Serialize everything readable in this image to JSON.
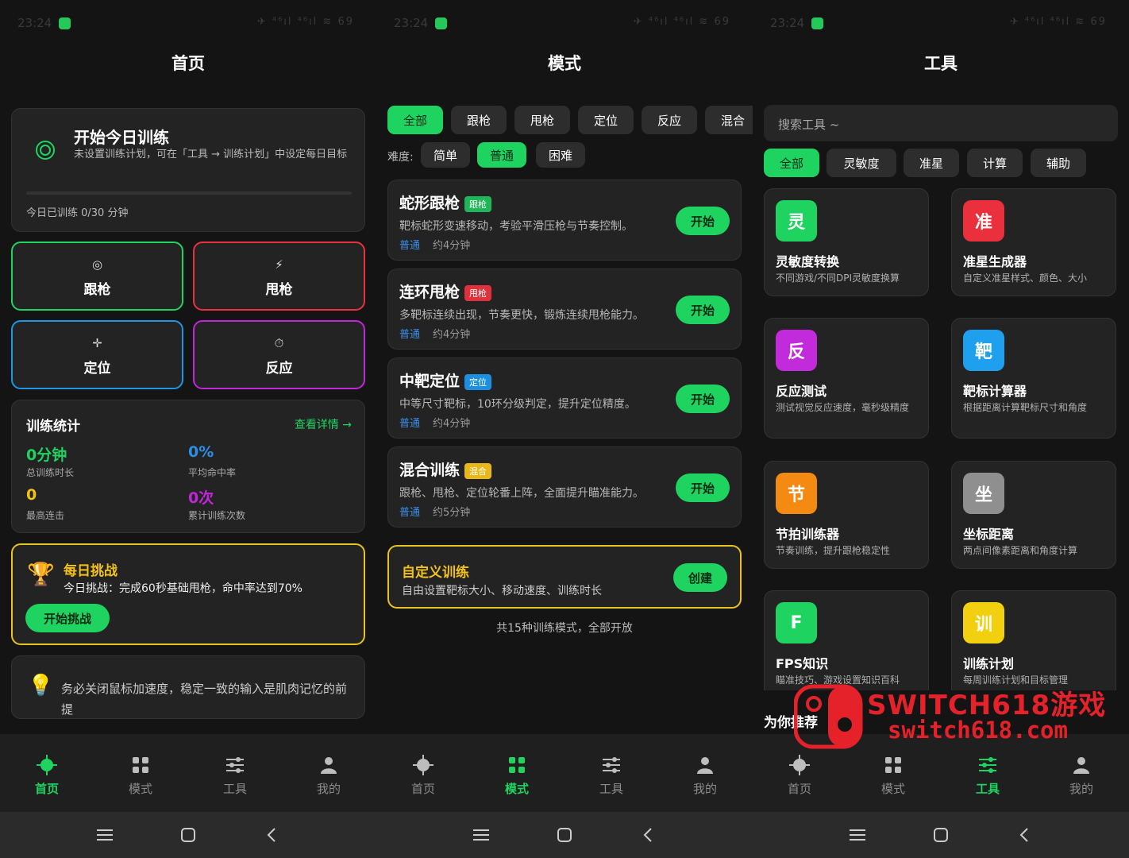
{
  "status": {
    "time": "23:24",
    "icons": "✈ ⁴⁶ıl ⁴⁶ıl ≋ 69"
  },
  "home": {
    "title": "首页",
    "today": {
      "title": "开始今日训练",
      "desc": "未设置训练计划，可在「工具 → 训练计划」中设定每日目标",
      "progress_text": "今日已训练 0/30 分钟",
      "progress": 0
    },
    "modes": [
      {
        "icon": "◎",
        "label": "跟枪",
        "color": "#1fd361"
      },
      {
        "icon": "⚡",
        "label": "甩枪",
        "color": "#e8333e"
      },
      {
        "icon": "✛",
        "label": "定位",
        "color": "#1e96e6"
      },
      {
        "icon": "⏱",
        "label": "反应",
        "color": "#c226d9"
      }
    ],
    "stats": {
      "title": "训练统计",
      "link": "查看详情 →",
      "items": [
        {
          "value": "0分钟",
          "label": "总训练时长",
          "color": "#1fd361"
        },
        {
          "value": "0%",
          "label": "平均命中率",
          "color": "#2c8fe6"
        },
        {
          "value": "0",
          "label": "最高连击",
          "color": "#f2c21b"
        },
        {
          "value": "0次",
          "label": "累计训练次数",
          "color": "#c226d9"
        }
      ]
    },
    "challenge": {
      "title": "每日挑战",
      "desc": "今日挑战：完成60秒基础甩枪，命中率达到70%",
      "button": "开始挑战"
    },
    "tip": "务必关闭鼠标加速度，稳定一致的输入是肌肉记忆的前提"
  },
  "modes_page": {
    "title": "模式",
    "filters": [
      "全部",
      "跟枪",
      "甩枪",
      "定位",
      "反应",
      "混合"
    ],
    "difficulty_label": "难度:",
    "difficulties": [
      "简单",
      "普通",
      "困难"
    ],
    "cards": [
      {
        "title": "蛇形跟枪",
        "tag": "跟枪",
        "tag_color": "#1fb657",
        "desc": "靶标蛇形变速移动，考验平滑压枪与节奏控制。",
        "level": "普通",
        "time": "约4分钟",
        "button": "开始"
      },
      {
        "title": "连环甩枪",
        "tag": "甩枪",
        "tag_color": "#e0303b",
        "desc": "多靶标连续出现，节奏更快，锻炼连续甩枪能力。",
        "level": "普通",
        "time": "约4分钟",
        "button": "开始"
      },
      {
        "title": "中靶定位",
        "tag": "定位",
        "tag_color": "#1e8fe0",
        "desc": "中等尺寸靶标，10环分级判定，提升定位精度。",
        "level": "普通",
        "time": "约4分钟",
        "button": "开始"
      },
      {
        "title": "混合训练",
        "tag": "混合",
        "tag_color": "#e8b81a",
        "desc": "跟枪、甩枪、定位轮番上阵，全面提升瞄准能力。",
        "level": "普通",
        "time": "约5分钟",
        "button": "开始"
      }
    ],
    "custom": {
      "title": "自定义训练",
      "desc": "自由设置靶标大小、移动速度、训练时长",
      "button": "创建"
    },
    "footer": "共15种训练模式，全部开放"
  },
  "tools_page": {
    "title": "工具",
    "search_placeholder": "搜索工具 ~",
    "filters": [
      "全部",
      "灵敏度",
      "准星",
      "计算",
      "辅助"
    ],
    "tools": [
      {
        "icon": "灵",
        "color": "#1fd361",
        "name": "灵敏度转换",
        "desc": "不同游戏/不同DPI灵敏度换算"
      },
      {
        "icon": "准",
        "color": "#ea2f3d",
        "name": "准星生成器",
        "desc": "自定义准星样式、颜色、大小"
      },
      {
        "icon": "反",
        "color": "#c22bdc",
        "name": "反应测试",
        "desc": "测试视觉反应速度，毫秒级精度"
      },
      {
        "icon": "靶",
        "color": "#1ea0ee",
        "name": "靶标计算器",
        "desc": "根据距离计算靶标尺寸和角度"
      },
      {
        "icon": "节",
        "color": "#f58a12",
        "name": "节拍训练器",
        "desc": "节奏训练，提升跟枪稳定性"
      },
      {
        "icon": "坐",
        "color": "#8f8f8f",
        "name": "坐标距离",
        "desc": "两点间像素距离和角度计算"
      },
      {
        "icon": "F",
        "color": "#1fd361",
        "name": "FPS知识",
        "desc": "瞄准技巧、游戏设置知识百科"
      },
      {
        "icon": "训",
        "color": "#f2d010",
        "name": "训练计划",
        "desc": "每周训练计划和目标管理"
      }
    ],
    "recommend": "为你推荐"
  },
  "nav": [
    "首页",
    "模式",
    "工具",
    "我的"
  ],
  "watermark": {
    "title": "SWITCH618游戏",
    "url": "switch618.com"
  },
  "colors": {
    "accent": "#1fd361",
    "bg": "#141414",
    "card": "#232323"
  }
}
